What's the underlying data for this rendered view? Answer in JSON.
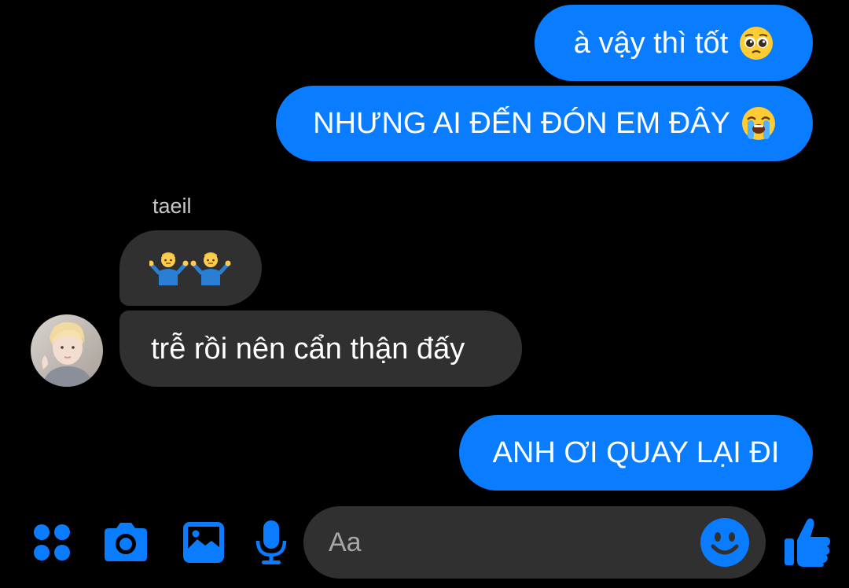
{
  "colors": {
    "outgoing_bubble": "#0a7cff",
    "incoming_bubble": "#303030",
    "accent": "#0a7cff",
    "background": "#000000"
  },
  "messages": [
    {
      "direction": "outgoing",
      "text": "à vậy thì tốt",
      "emoji": "pleading-face-emoji"
    },
    {
      "direction": "outgoing",
      "text": "NHƯNG AI ĐẾN ĐÓN EM ĐÂY",
      "emoji": "loudly-crying-face-emoji"
    },
    {
      "direction": "incoming",
      "sender": "taeil",
      "emoji": "man-shrugging-emoji x2"
    },
    {
      "direction": "incoming",
      "text": "trễ rồi nên cẩn thận đấy"
    },
    {
      "direction": "outgoing",
      "text": "ANH ƠI QUAY LẠI ĐI"
    }
  ],
  "thread": {
    "sender_name": "taeil"
  },
  "composer": {
    "placeholder": "Aa",
    "icons": [
      "menu-dots-icon",
      "camera-icon",
      "gallery-icon",
      "microphone-icon",
      "emoji-icon",
      "thumbs-up-icon"
    ]
  }
}
